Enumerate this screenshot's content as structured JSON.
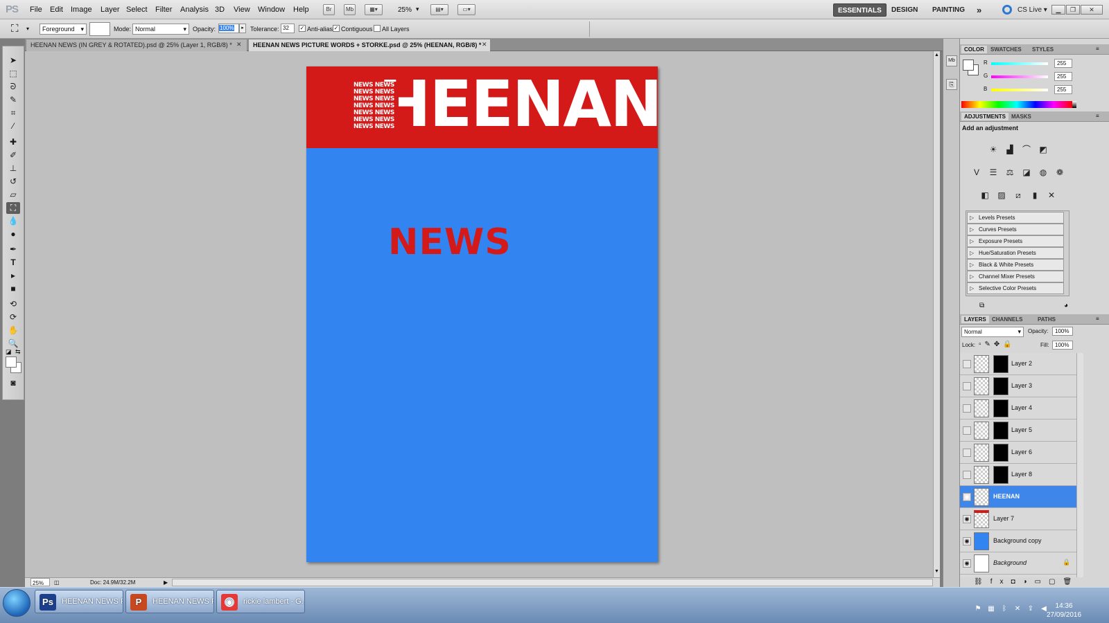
{
  "app": {
    "logo": "PS"
  },
  "menu": [
    "File",
    "Edit",
    "Image",
    "Layer",
    "Select",
    "Filter",
    "Analysis",
    "3D",
    "View",
    "Window",
    "Help"
  ],
  "appbar": {
    "br": "Br",
    "mb": "Mb",
    "zoom": "25%"
  },
  "workspaces": {
    "essentials": "ESSENTIALS",
    "design": "DESIGN",
    "painting": "PAINTING",
    "more": "»",
    "cslive": "CS Live ▾"
  },
  "options": {
    "preset": "Foreground",
    "mode_label": "Mode:",
    "mode": "Normal",
    "opacity_label": "Opacity:",
    "opacity": "100%",
    "tolerance_label": "Tolerance:",
    "tolerance": "32",
    "antialias": "Anti-alias",
    "contiguous": "Contiguous",
    "all_layers": "All Layers"
  },
  "tabs": [
    {
      "label": "HEENAN NEWS (IN GREY & ROTATED).psd @ 25% (Layer 1, RGB/8) *"
    },
    {
      "label": "HEENAN NEWS PICTURE WORDS + STORKE.psd @ 25% (HEENAN, RGB/8) *"
    }
  ],
  "document": {
    "title_text": "HEENAN",
    "pattern_word": "NEWS",
    "news_text": "NEWS",
    "bg_color": "#3285f0",
    "banner_color": "#d41919"
  },
  "status": {
    "zoom": "25%",
    "doc": "Doc: 24.9M/32.2M"
  },
  "color_panel": {
    "tabs": [
      "COLOR",
      "SWATCHES",
      "STYLES"
    ],
    "channels": [
      {
        "name": "R",
        "value": "255"
      },
      {
        "name": "G",
        "value": "255"
      },
      {
        "name": "B",
        "value": "255"
      }
    ]
  },
  "adjustments": {
    "tabs": [
      "ADJUSTMENTS",
      "MASKS"
    ],
    "title": "Add an adjustment",
    "presets": [
      "Levels Presets",
      "Curves Presets",
      "Exposure Presets",
      "Hue/Saturation Presets",
      "Black & White Presets",
      "Channel Mixer Presets",
      "Selective Color Presets"
    ]
  },
  "layers": {
    "tabs": [
      "LAYERS",
      "CHANNELS",
      "PATHS"
    ],
    "blend": "Normal",
    "opacity_label": "Opacity:",
    "opacity": "100%",
    "lock_label": "Lock:",
    "fill_label": "Fill:",
    "fill": "100%",
    "items": [
      {
        "name": "Layer 2"
      },
      {
        "name": "Layer 3"
      },
      {
        "name": "Layer 4"
      },
      {
        "name": "Layer 5"
      },
      {
        "name": "Layer 6"
      },
      {
        "name": "Layer 8"
      },
      {
        "name": "HEENAN"
      },
      {
        "name": "Layer 7"
      },
      {
        "name": "Background copy"
      },
      {
        "name": "Background"
      }
    ]
  },
  "taskbar": {
    "items": [
      {
        "label": "HEENAN NEWS PI...",
        "icon": "Ps"
      },
      {
        "label": "HEENAN NEWS P...",
        "icon": "P"
      },
      {
        "label": "rickie lambert - G...",
        "icon": "◉"
      }
    ],
    "time": "14:36",
    "date": "27/09/2016"
  }
}
